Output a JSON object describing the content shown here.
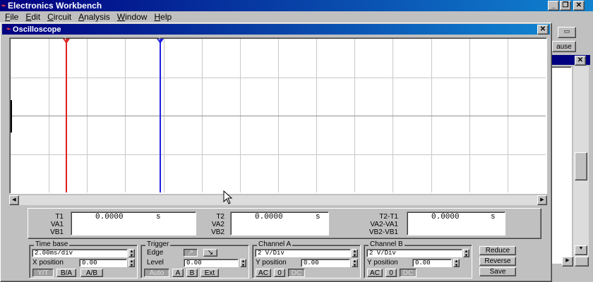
{
  "app": {
    "title": "Electronics Workbench",
    "menu": [
      {
        "pre": "",
        "key": "F",
        "post": "ile"
      },
      {
        "pre": "",
        "key": "E",
        "post": "dit"
      },
      {
        "pre": "",
        "key": "C",
        "post": "ircuit"
      },
      {
        "pre": "",
        "key": "A",
        "post": "nalysis"
      },
      {
        "pre": "",
        "key": "W",
        "post": "indow"
      },
      {
        "pre": "",
        "key": "H",
        "post": "elp"
      }
    ],
    "controls": {
      "minimize": "_",
      "restore": "❐",
      "close": "✕"
    }
  },
  "background": {
    "pause_label": "ause",
    "close_label": "✕"
  },
  "oscilloscope": {
    "title": "Oscilloscope",
    "close_label": "✕",
    "cursor1_label": "1",
    "cursor2_label": "2",
    "colors": {
      "cursor1": "#e02020",
      "cursor2": "#2020e0",
      "grid": "#c8c8c8",
      "screen": "#ffffff"
    },
    "readouts": [
      {
        "labels": [
          "T1",
          "VA1",
          "VB1"
        ],
        "value": "0.0000",
        "unit": "s"
      },
      {
        "labels": [
          "T2",
          "VA2",
          "VB2"
        ],
        "value": "0.0000",
        "unit": "s"
      },
      {
        "labels": [
          "T2-T1",
          "VA2-VA1",
          "VB2-VB1"
        ],
        "value": "0.0000",
        "unit": "s"
      }
    ],
    "timebase": {
      "label": "Time base",
      "value": "2.00ms/div",
      "xpos_label": "X position",
      "xpos_value": "0.00",
      "modes": [
        "Y/T",
        "B/A",
        "A/B"
      ]
    },
    "trigger": {
      "label": "Trigger",
      "edge_label": "Edge",
      "edge_rise": "↗",
      "edge_fall": "↘",
      "level_label": "Level",
      "level_value": "0.00",
      "sources": [
        "Auto",
        "A",
        "B",
        "Ext"
      ]
    },
    "channel_a": {
      "label": "Channel A",
      "value": "2 V/Div",
      "ypos_label": "Y position",
      "ypos_value": "0.00",
      "coupling": [
        "AC",
        "0",
        "DC"
      ]
    },
    "channel_b": {
      "label": "Channel B",
      "value": "2 V/Div",
      "ypos_label": "Y position",
      "ypos_value": "0.00",
      "coupling": [
        "AC",
        "0",
        "DC"
      ]
    },
    "actions": [
      "Reduce",
      "Reverse",
      "Save"
    ]
  }
}
